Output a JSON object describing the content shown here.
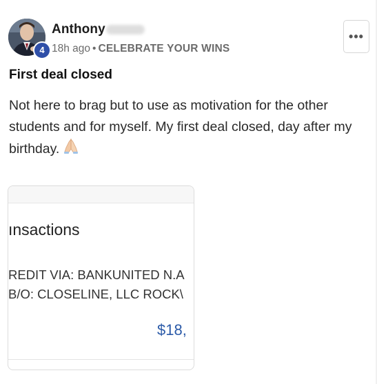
{
  "author": {
    "name": "Anthony",
    "level": "4",
    "avatar": "avatar-photo"
  },
  "meta": {
    "time": "18h ago",
    "separator": "•",
    "category": "CELEBRATE YOUR WINS"
  },
  "menu": {
    "icon": "more-options-icon",
    "label": "•••"
  },
  "post": {
    "title": "First deal closed",
    "body": "Not here to brag but to use as motivation for the other students and for myself. My first deal closed, day after my birthday.",
    "emoji": "folded-hands-icon"
  },
  "attachment": {
    "heading": "ınsactions",
    "line1": "REDIT VIA: BANKUNITED N.A",
    "line2": "B/O: CLOSELINE, LLC ROCK\\",
    "amount": "$18,",
    "amount_color": "#2b5aa8"
  },
  "colors": {
    "badge": "#2f4fa8",
    "category_text": "#6b6b6b"
  }
}
